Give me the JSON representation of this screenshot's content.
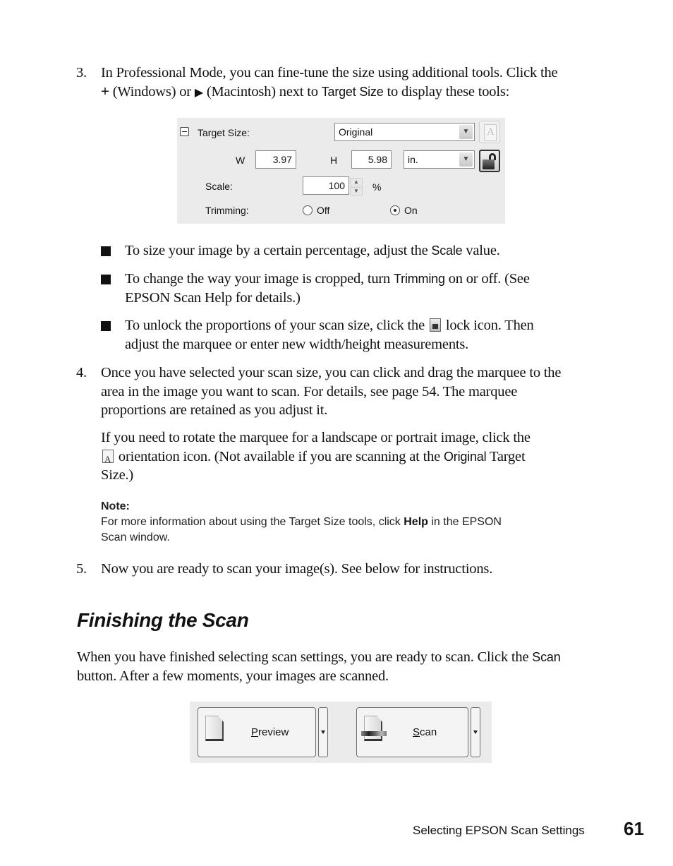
{
  "step3": {
    "number": "3.",
    "line1": "In Professional Mode, you can fine-tune the size using additional tools. Click the",
    "line2_a": "+",
    "line2_b": " (Windows) or ",
    "line2_arrow": "▶",
    "line2_c": " (Macintosh) next to ",
    "line2_bold": "Target Size",
    "line2_d": " to display these tools:"
  },
  "target_size_panel": {
    "target_size_label": "Target Size:",
    "target_size_value": "Original",
    "w_label": "W",
    "w_value": "3.97",
    "h_label": "H",
    "h_value": "5.98",
    "unit_value": "in.",
    "scale_label": "Scale:",
    "scale_value": "100",
    "scale_unit": "%",
    "trimming_label": "Trimming:",
    "trimming_off": "Off",
    "trimming_on": "On",
    "trimming_selected": "On"
  },
  "bullets": [
    {
      "a": "To size your image by a certain percentage, adjust the ",
      "bold": "Scale",
      "b": " value."
    },
    {
      "a": "To change the way your image is cropped, turn ",
      "bold": "Trimming",
      "b": " on or off. (See",
      "line2": "EPSON Scan Help for details.)"
    },
    {
      "a": "To unlock the proportions of your scan size, click the ",
      "b": " lock icon. Then",
      "line2": "adjust the marquee or enter new width/height measurements."
    }
  ],
  "step4": {
    "number": "4.",
    "line1": "Once you have selected your scan size, you can click and drag the marquee to the",
    "line2": "area in the image you want to scan. For details, see page 54. The marquee",
    "line3": "proportions are retained as you adjust it.",
    "p2_line1": "If you need to rotate the marquee for a landscape or portrait image, click the",
    "p2_line2_a": " orientation icon. (Not available if you are scanning at the ",
    "p2_line2_bold": "Original",
    "p2_line2_b": " Target",
    "p2_line3": "Size.)"
  },
  "note": {
    "title": "Note:",
    "line1_a": "For more information about using the Target Size tools, click ",
    "line1_bold": "Help",
    "line1_b": " in the EPSON",
    "line2": "Scan window."
  },
  "step5": {
    "number": "5.",
    "text": "Now you are ready to scan your image(s). See below for instructions."
  },
  "section": {
    "heading": "Finishing the Scan",
    "line1_a": "When you have finished selecting scan settings, you are ready to scan. Click the ",
    "line1_bold": "Scan",
    "line2": "button. After a few moments, your images are scanned."
  },
  "buttons": {
    "preview_mnemonic": "P",
    "preview_rest": "review",
    "scan_mnemonic": "S",
    "scan_rest": "can"
  },
  "footer": {
    "section_title": "Selecting EPSON Scan Settings",
    "page_number": "61"
  }
}
